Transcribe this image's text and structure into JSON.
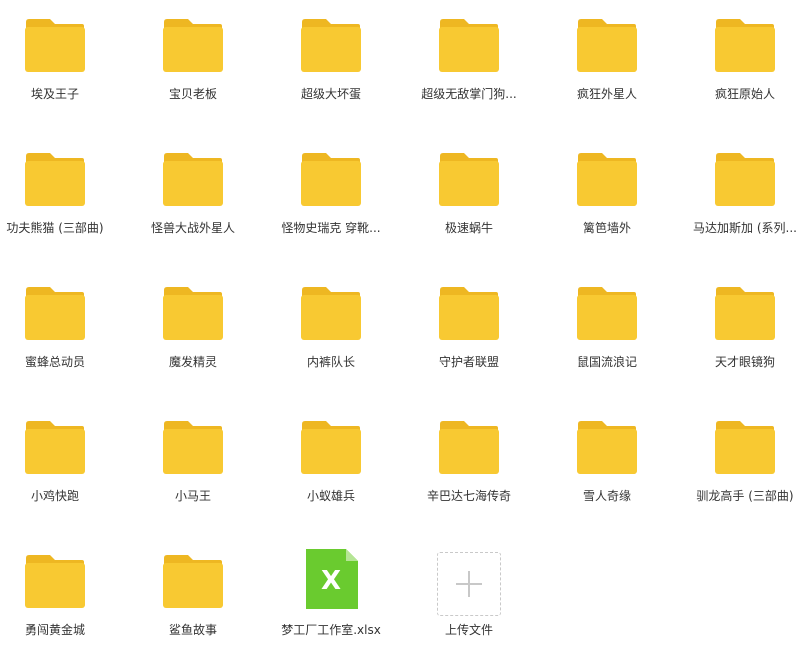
{
  "colors": {
    "folder_tab": "#EEB722",
    "folder_body": "#F8C932",
    "xlsx_green": "#6ACB2F",
    "xlsx_fold": "#B5E595",
    "upload_border": "#C9C9C9",
    "upload_plus": "#C8C8C8",
    "label_text": "#333333"
  },
  "items": [
    {
      "label": "埃及王子",
      "icon": "folder-icon"
    },
    {
      "label": "宝贝老板",
      "icon": "folder-icon"
    },
    {
      "label": "超级大坏蛋",
      "icon": "folder-icon"
    },
    {
      "label": "超级无敌掌门狗...",
      "icon": "folder-icon"
    },
    {
      "label": "疯狂外星人",
      "icon": "folder-icon"
    },
    {
      "label": "疯狂原始人",
      "icon": "folder-icon"
    },
    {
      "label": "功夫熊猫 (三部曲)",
      "icon": "folder-icon"
    },
    {
      "label": "怪兽大战外星人",
      "icon": "folder-icon"
    },
    {
      "label": "怪物史瑞克 穿靴...",
      "icon": "folder-icon"
    },
    {
      "label": "极速蜗牛",
      "icon": "folder-icon"
    },
    {
      "label": "篱笆墙外",
      "icon": "folder-icon"
    },
    {
      "label": "马达加斯加 (系列...",
      "icon": "folder-icon"
    },
    {
      "label": "蜜蜂总动员",
      "icon": "folder-icon"
    },
    {
      "label": "魔发精灵",
      "icon": "folder-icon"
    },
    {
      "label": "内裤队长",
      "icon": "folder-icon"
    },
    {
      "label": "守护者联盟",
      "icon": "folder-icon"
    },
    {
      "label": "鼠国流浪记",
      "icon": "folder-icon"
    },
    {
      "label": "天才眼镜狗",
      "icon": "folder-icon"
    },
    {
      "label": "小鸡快跑",
      "icon": "folder-icon"
    },
    {
      "label": "小马王",
      "icon": "folder-icon"
    },
    {
      "label": "小蚁雄兵",
      "icon": "folder-icon"
    },
    {
      "label": "辛巴达七海传奇",
      "icon": "folder-icon"
    },
    {
      "label": "雪人奇缘",
      "icon": "folder-icon"
    },
    {
      "label": "驯龙高手 (三部曲)",
      "icon": "folder-icon"
    },
    {
      "label": "勇闯黄金城",
      "icon": "folder-icon"
    },
    {
      "label": "鲨鱼故事",
      "icon": "folder-icon"
    },
    {
      "label": "梦工厂工作室.xlsx",
      "icon": "xlsx-file-icon",
      "glyph": "X"
    },
    {
      "label": "上传文件",
      "icon": "upload-plus-icon"
    }
  ]
}
